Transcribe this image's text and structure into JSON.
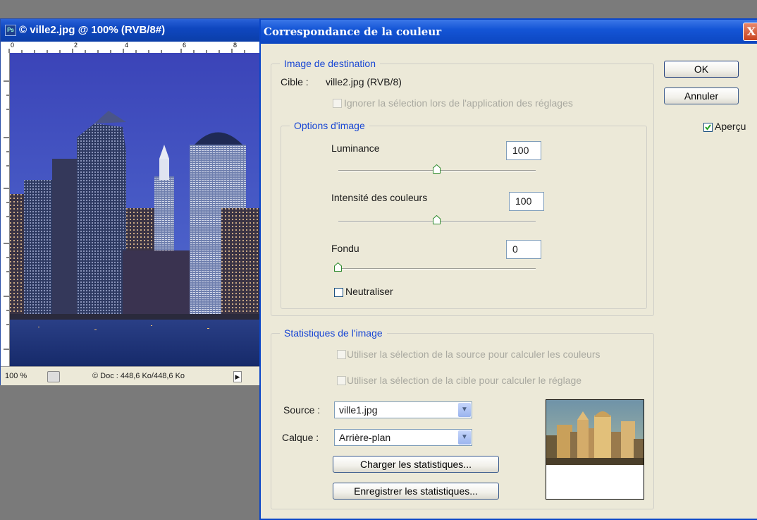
{
  "document_window": {
    "title": "© ville2.jpg @ 100% (RVB/8#)",
    "ruler_top": [
      "0",
      "2",
      "4",
      "6",
      "8"
    ],
    "zoom": "100 %",
    "doc_size": "© Doc : 448,6 Ko/448,6 Ko"
  },
  "dialog": {
    "title": "Correspondance de la couleur",
    "close": "X",
    "ok": "OK",
    "cancel": "Annuler",
    "preview": "Aperçu",
    "preview_checked": true,
    "destination": {
      "legend": "Image de destination",
      "target_label": "Cible :",
      "target_value": "ville2.jpg (RVB/8)",
      "ignore_selection": "Ignorer la sélection lors de l'application des réglages"
    },
    "options": {
      "legend": "Options d'image",
      "luminance_label": "Luminance",
      "luminance_value": "100",
      "intensity_label": "Intensité des couleurs",
      "intensity_value": "100",
      "fade_label": "Fondu",
      "fade_value": "0",
      "neutralize": "Neutraliser"
    },
    "stats": {
      "legend": "Statistiques de l'image",
      "use_source_selection": "Utiliser la sélection de la source pour calculer les couleurs",
      "use_target_selection": "Utiliser la sélection de la cible pour calculer le réglage",
      "source_label": "Source :",
      "source_value": "ville1.jpg",
      "layer_label": "Calque :",
      "layer_value": "Arrière-plan",
      "load_stats": "Charger les statistiques...",
      "save_stats": "Enregistrer les statistiques..."
    }
  },
  "colors": {
    "title_bar": "#0f47c0",
    "legend_text": "#1846d4",
    "dialog_bg": "#ece9d8",
    "workspace": "#7a7a7a"
  },
  "icons": [
    "photoshop-icon",
    "close-icon",
    "dropdown-arrow-icon",
    "slider-thumb-icon",
    "status-icon",
    "play-arrow-icon"
  ]
}
